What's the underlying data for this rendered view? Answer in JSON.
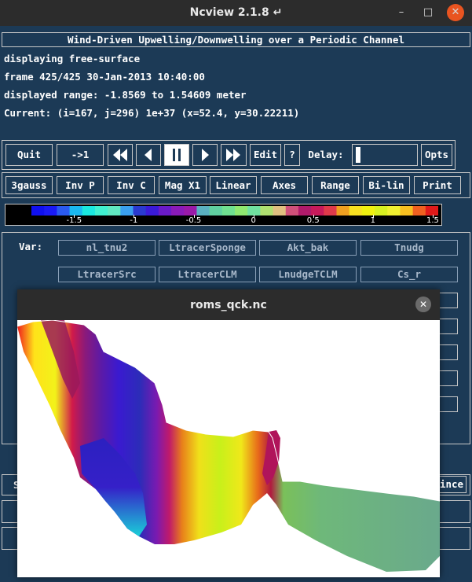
{
  "window": {
    "title": "Ncview 2.1.8 ↵",
    "minimize_glyph": "–",
    "maximize_glyph": "□",
    "close_glyph": "✕"
  },
  "info": {
    "heading": "Wind-Driven Upwelling/Downwelling over a Periodic Channel",
    "displaying": "displaying free-surface",
    "frame": "frame 425/425 30-Jan-2013 10:40:00",
    "range": "displayed range: -1.8569 to 1.54609 meter",
    "current": "Current: (i=167, j=296) 1e+37 (x=52.4, y=30.22211)"
  },
  "controls": {
    "quit": "Quit",
    "goto_first": "->1",
    "rewind_icon": "fast-rewind-icon",
    "back_icon": "step-back-icon",
    "pause_icon": "pause-icon",
    "forward_icon": "step-forward-icon",
    "fastforward_icon": "fast-forward-icon",
    "edit": "Edit",
    "help": "?",
    "delay_label": "Delay:",
    "delay_fraction": 0.03,
    "opts": "Opts"
  },
  "options": [
    "3gauss",
    "Inv P",
    "Inv C",
    "Mag X1",
    "Linear",
    "Axes",
    "Range",
    "Bi-lin",
    "Print"
  ],
  "colorbar": {
    "ticks": [
      "-1.5",
      "-1",
      "-0.5",
      "0",
      "0.5",
      "1",
      "1.5"
    ],
    "min": -1.8569,
    "max": 1.54609
  },
  "vars": {
    "label": "Var:",
    "row1": [
      "nl_tnu2",
      "LtracerSponge",
      "Akt_bak",
      "Tnudg"
    ],
    "row2": [
      "LtracerSrc",
      "LtracerCLM",
      "LnudgeTCLM",
      "Cs_r"
    ]
  },
  "lower": {
    "left_fragment": "S",
    "right_fragment": "ince"
  },
  "popup": {
    "title": "roms_qck.nc",
    "close_glyph": "✕"
  }
}
